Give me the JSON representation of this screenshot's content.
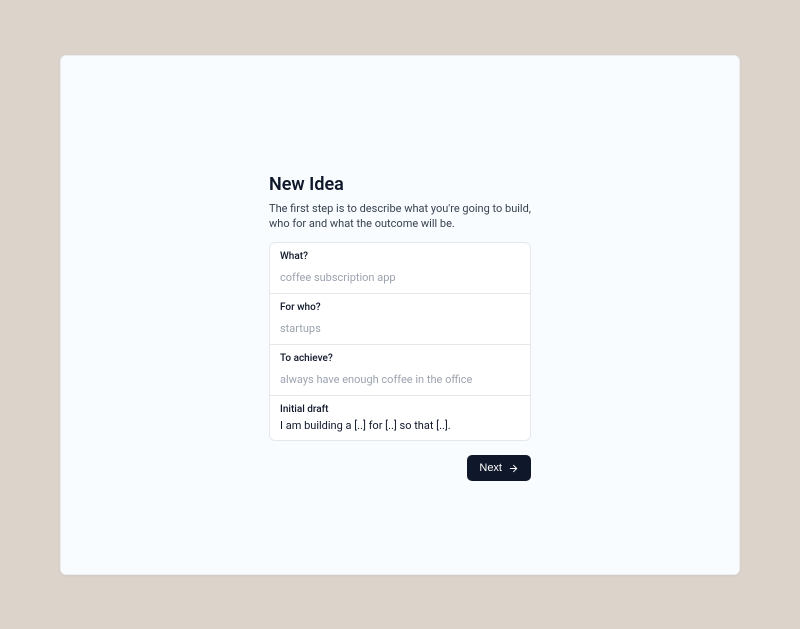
{
  "header": {
    "title": "New Idea",
    "description": "The first step is to describe what you're going to build, who for and what the outcome will be."
  },
  "form": {
    "what": {
      "label": "What?",
      "placeholder": "coffee subscription app",
      "value": ""
    },
    "for_who": {
      "label": "For who?",
      "placeholder": "startups",
      "value": ""
    },
    "to_achieve": {
      "label": "To achieve?",
      "placeholder": "always have enough coffee in the office",
      "value": ""
    },
    "initial_draft": {
      "label": "Initial draft",
      "text": "I am building a [..] for [..] so that [..]."
    }
  },
  "buttons": {
    "next": "Next"
  },
  "colors": {
    "background": "#dcd4cb",
    "window": "#f9fcfe",
    "primary": "#0f172a",
    "border": "#e5e7eb",
    "placeholder": "#9ca3af"
  }
}
